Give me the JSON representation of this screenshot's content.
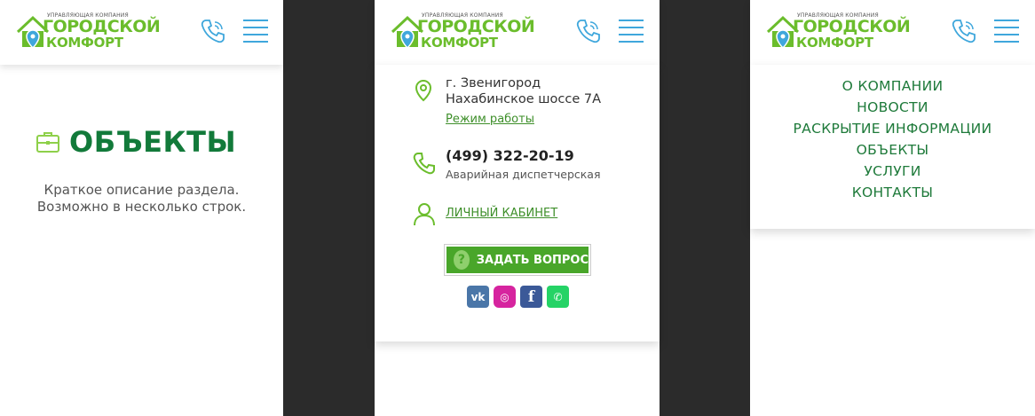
{
  "brand": {
    "company_type": "УПРАВЛЯЮЩАЯ КОМПАНИЯ",
    "name_line1": "ГОРОДСКОЙ",
    "name_line2": "КОМФОРТ"
  },
  "colors": {
    "brand_green": "#6bbd2c",
    "title_green": "#127a3a",
    "link_green": "#3e8f2a",
    "icon_blue": "#3fa7dc",
    "button_green": "#49a62a",
    "gap_dark": "#2b2b2b"
  },
  "icons": {
    "phone": "phone-icon",
    "menu": "hamburger-menu-icon",
    "section": "briefcase-icon",
    "address": "map-pin-icon",
    "tel": "handset-icon",
    "user": "user-icon",
    "question": "question-icon"
  },
  "page": {
    "title": "ОБЪЕКТЫ",
    "description_line1": "Краткое описание раздела.",
    "description_line2": "Возможно в несколько строк."
  },
  "contacts": {
    "address_line1": "г. Звенигород",
    "address_line2": "Нахабинское шоссе 7А",
    "hours_link": "Режим работы",
    "phone": "(499) 322-20-19",
    "phone_caption": "Аварийная диспетчерская",
    "cabinet_link": "ЛИЧНЫЙ КАБИНЕТ",
    "ask_button": "ЗАДАТЬ ВОПРОС",
    "question_mark": "?"
  },
  "socials": [
    {
      "name": "vk",
      "glyph": "vk"
    },
    {
      "name": "instagram",
      "glyph": "◎"
    },
    {
      "name": "facebook",
      "glyph": "f"
    },
    {
      "name": "whatsapp",
      "glyph": "✆"
    }
  ],
  "menu": {
    "items": [
      "О КОМПАНИИ",
      "НОВОСТИ",
      "РАСКРЫТИЕ ИНФОРМАЦИИ",
      "ОБЪЕКТЫ",
      "УСЛУГИ",
      "КОНТАКТЫ"
    ]
  }
}
